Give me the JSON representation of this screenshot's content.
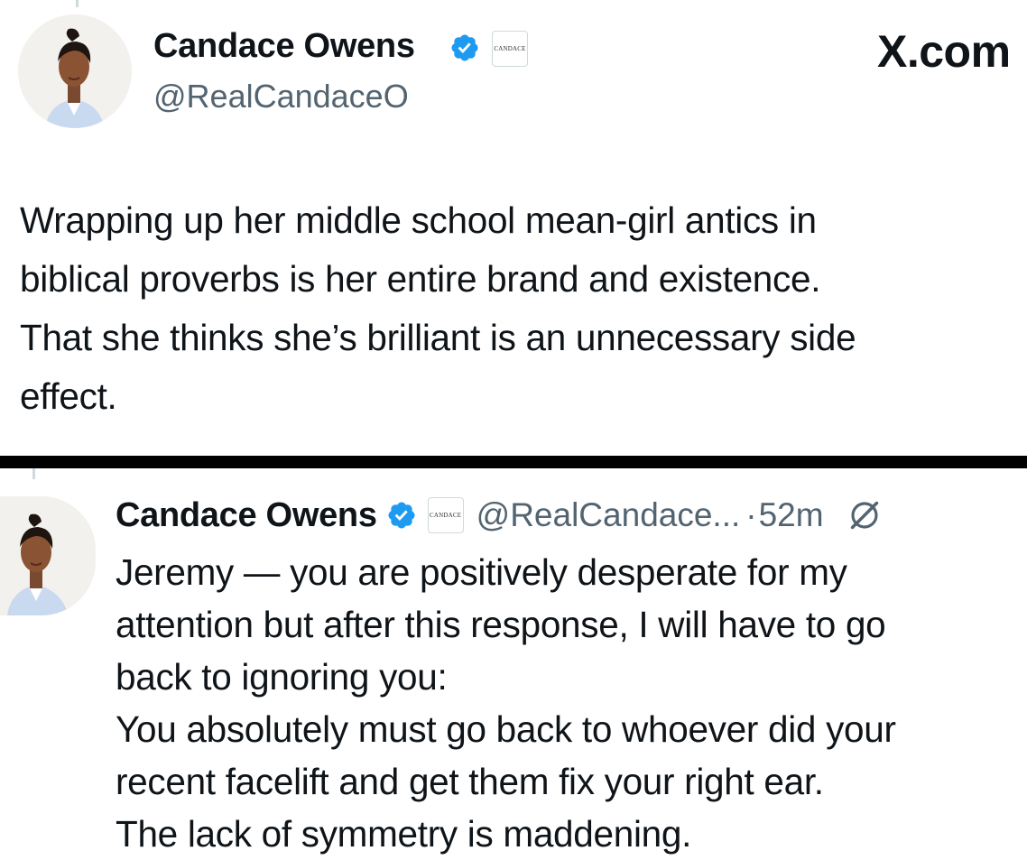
{
  "site_mark": "X.com",
  "top_post": {
    "display_name": "Candace Owens",
    "handle": "@RealCandaceO",
    "affiliate_badge_text": "CANDACE",
    "lines": [
      "Wrapping up her middle school mean-girl antics in",
      "biblical proverbs is her entire brand and existence.",
      "That she thinks she’s brilliant is an unnecessary side",
      "effect."
    ]
  },
  "bottom_post": {
    "display_name": "Candace Owens",
    "handle": "@RealCandace...",
    "separator": "·",
    "time": "52m",
    "affiliate_badge_text": "CANDACE",
    "lines": [
      "Jeremy — you are positively desperate for my",
      "attention but after this response, I will have to go",
      "back to ignoring you:",
      "You absolutely must go back to whoever did your",
      "recent facelift and get them fix your right ear.",
      "The lack of symmetry is maddening."
    ]
  },
  "colors": {
    "verified_blue": "#1d9bf0",
    "secondary_text": "#536471",
    "divider": "#000000"
  },
  "icons": [
    "verified-badge-icon",
    "affiliate-badge-icon",
    "grok-icon"
  ]
}
